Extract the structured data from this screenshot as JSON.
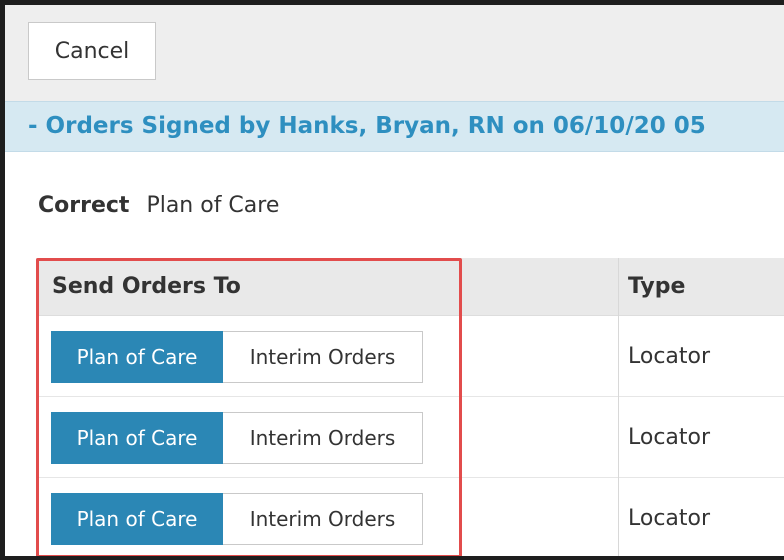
{
  "toolbar": {
    "cancel_label": "Cancel"
  },
  "section": {
    "header": "- Orders Signed by Hanks, Bryan, RN on 06/10/20 05"
  },
  "correct": {
    "label": "Correct",
    "value": "Plan of Care"
  },
  "table": {
    "headers": [
      "Send Orders To",
      "Type"
    ],
    "rows": [
      {
        "options": [
          "Plan of Care",
          "Interim Orders"
        ],
        "selected": "Plan of Care",
        "type": "Locator"
      },
      {
        "options": [
          "Plan of Care",
          "Interim Orders"
        ],
        "selected": "Plan of Care",
        "type": "Locator"
      },
      {
        "options": [
          "Plan of Care",
          "Interim Orders"
        ],
        "selected": "Plan of Care",
        "type": "Locator"
      }
    ]
  },
  "colors": {
    "accent_blue": "#2b87b5",
    "header_text": "#2e8fc0",
    "header_bg": "#d6e9f2",
    "highlight_red": "#e24c4c"
  }
}
